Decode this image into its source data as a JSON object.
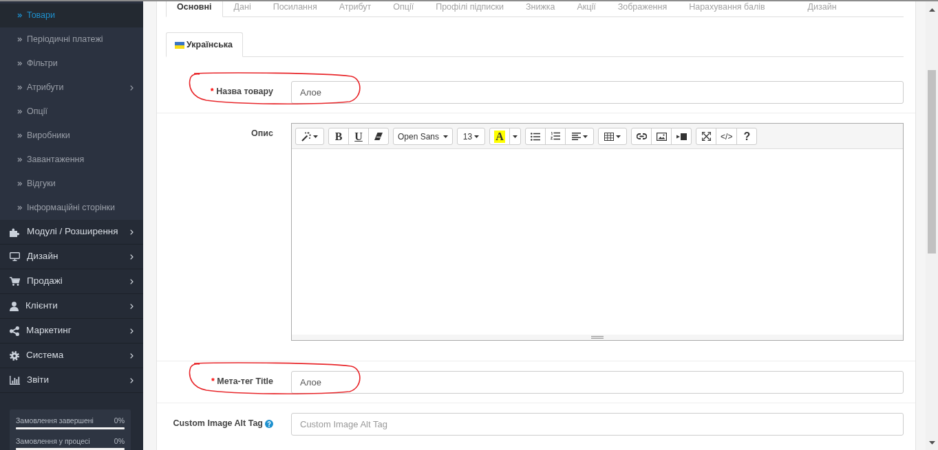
{
  "sidebar": {
    "submenu_items": [
      {
        "label": "Товари",
        "selected": true,
        "has_submenu": false
      },
      {
        "label": "Періодичні платежі",
        "selected": false,
        "has_submenu": false
      },
      {
        "label": "Фільтри",
        "selected": false,
        "has_submenu": false
      },
      {
        "label": "Атрибути",
        "selected": false,
        "has_submenu": true
      },
      {
        "label": "Опції",
        "selected": false,
        "has_submenu": false
      },
      {
        "label": "Виробники",
        "selected": false,
        "has_submenu": false
      },
      {
        "label": "Завантаження",
        "selected": false,
        "has_submenu": false
      },
      {
        "label": "Відгуки",
        "selected": false,
        "has_submenu": false
      },
      {
        "label": "Інформаційні сторінки",
        "selected": false,
        "has_submenu": false
      }
    ],
    "menu_items": [
      {
        "label": "Модулі / Розширення",
        "selected": false,
        "has_submenu": true
      },
      {
        "label": "Дизайн",
        "selected": false,
        "has_submenu": true
      },
      {
        "label": "Продажі",
        "selected": false,
        "has_submenu": true
      },
      {
        "label": "Клієнти",
        "selected": false,
        "has_submenu": true
      },
      {
        "label": "Маркетинг",
        "selected": false,
        "has_submenu": true
      },
      {
        "label": "Система",
        "selected": false,
        "has_submenu": true
      },
      {
        "label": "Звіти",
        "selected": false,
        "has_submenu": true
      }
    ],
    "progress": [
      {
        "label": "Замовлення завершені",
        "reading": "0%",
        "level": 0
      },
      {
        "label": "Замовлення у процесі",
        "reading": "0%",
        "level": 0
      }
    ]
  },
  "tabs": [
    {
      "label": "Основні",
      "selected": true
    },
    {
      "label": "Дані",
      "selected": false
    },
    {
      "label": "Посилання",
      "selected": false
    },
    {
      "label": "Атрибут",
      "selected": false
    },
    {
      "label": "Опції",
      "selected": false
    },
    {
      "label": "Профілі підписки",
      "selected": false
    },
    {
      "label": "Знижка",
      "selected": false
    },
    {
      "label": "Акції",
      "selected": false
    },
    {
      "label": "Зображення",
      "selected": false
    },
    {
      "label": "Нарахування балів",
      "selected": false
    },
    {
      "label": "Дизайн",
      "selected": false
    }
  ],
  "language_tabs": [
    {
      "label": "Українська",
      "selected": true
    }
  ],
  "form": {
    "rows": [
      {
        "kind": "input",
        "required_mark": "*",
        "label": "Назва товару",
        "value": "Алое",
        "has_help": false,
        "circled": true
      },
      {
        "kind": "editor",
        "label": "Опис",
        "has_help": false,
        "circled": false,
        "toolbar": [
          [
            {
              "kind": "style"
            }
          ],
          [
            {
              "kind": "bold",
              "label": "B"
            },
            {
              "kind": "underline",
              "label": "U"
            },
            {
              "kind": "clear"
            }
          ],
          [
            {
              "kind": "font",
              "label": "Open Sans"
            }
          ],
          [
            {
              "kind": "size",
              "label": "13"
            }
          ],
          [
            {
              "kind": "color",
              "label": "A"
            },
            {
              "kind": "color-menu"
            }
          ],
          [
            {
              "kind": "ul"
            },
            {
              "kind": "ol"
            },
            {
              "kind": "align"
            }
          ],
          [
            {
              "kind": "table"
            }
          ],
          [
            {
              "kind": "link"
            },
            {
              "kind": "picture"
            },
            {
              "kind": "video"
            }
          ],
          [
            {
              "kind": "fullscreen"
            },
            {
              "kind": "code",
              "label": "</>"
            },
            {
              "kind": "help",
              "label": "?"
            }
          ]
        ]
      },
      {
        "kind": "input",
        "required_mark": "*",
        "label": "Мета-тег Title",
        "value": "Алое",
        "has_help": false,
        "circled": true
      },
      {
        "kind": "input",
        "label": "Custom Image Alt Tag",
        "placeholder": "Custom Image Alt Tag",
        "has_help": true,
        "circled": false
      }
    ]
  }
}
